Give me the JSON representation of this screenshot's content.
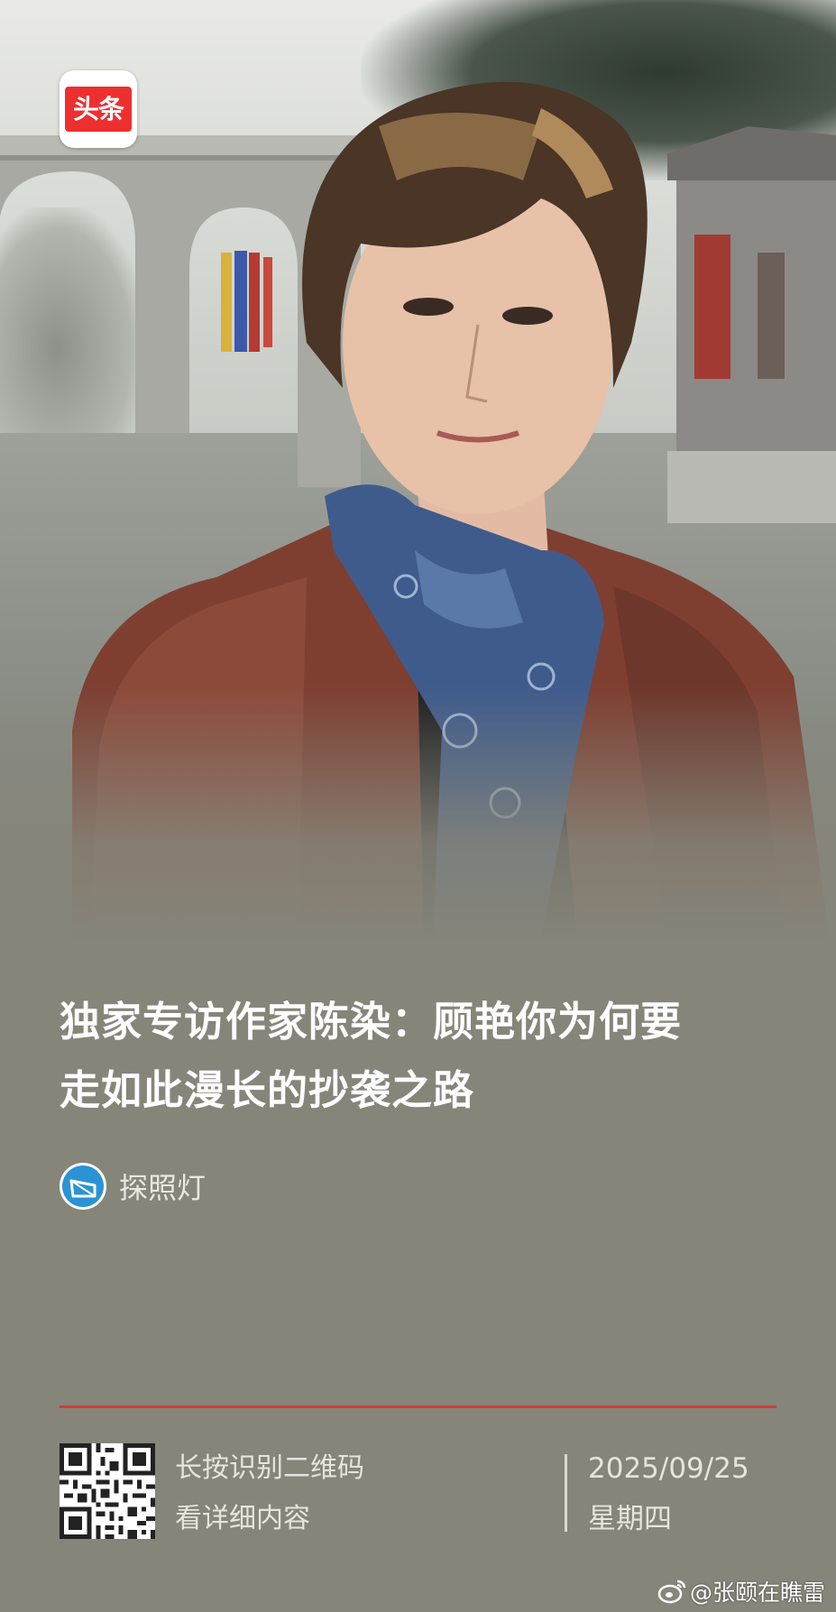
{
  "header": {
    "app_logo_text": "头条"
  },
  "article": {
    "title_line1": "独家专访作家陈染：顾艳你为何要",
    "title_line2": "走如此漫长的抄袭之路",
    "author": "探照灯"
  },
  "footer": {
    "scan_line1": "长按识别二维码",
    "scan_line2": "看详细内容",
    "date": "2025/09/25",
    "weekday": "星期四"
  },
  "watermark": {
    "handle": "@张颐在瞧雷"
  },
  "colors": {
    "background": "#86857a",
    "accent_red": "#d43a33",
    "logo_red": "#ee2f2f",
    "author_avatar_blue": "#2a93d5"
  },
  "icons": [
    "toutiao-logo-icon",
    "author-avatar-icon",
    "qr-code-icon",
    "weibo-icon"
  ]
}
